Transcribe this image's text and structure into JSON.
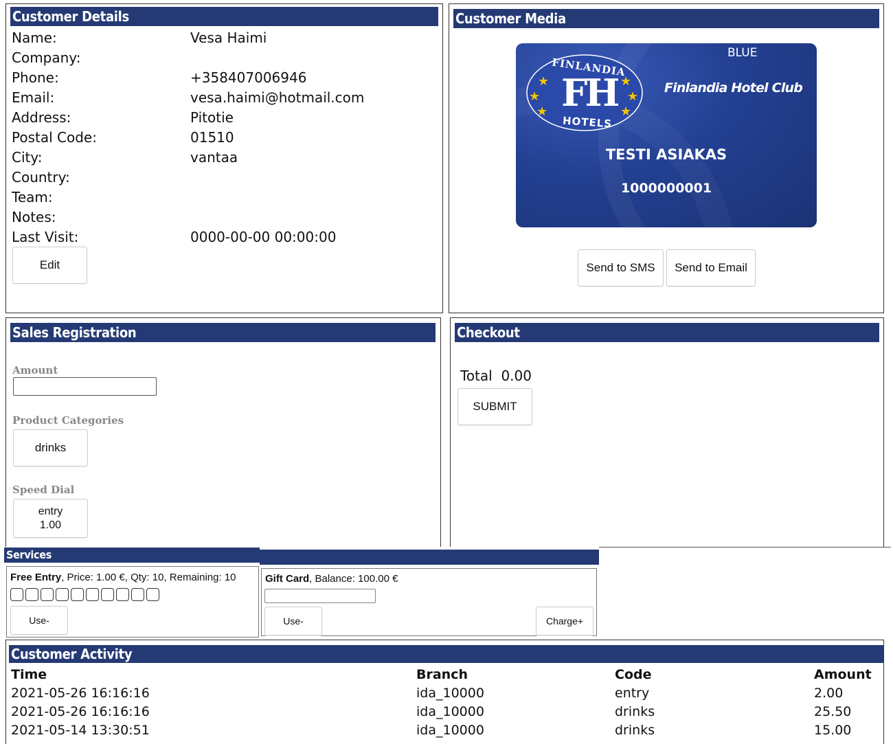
{
  "customer_details": {
    "title": "Customer Details",
    "fields": [
      {
        "label": "Name:",
        "value": "Vesa Haimi"
      },
      {
        "label": "Company:",
        "value": ""
      },
      {
        "label": "Phone:",
        "value": "+358407006946"
      },
      {
        "label": "Email:",
        "value": "vesa.haimi@hotmail.com"
      },
      {
        "label": "Address:",
        "value": "Pitotie"
      },
      {
        "label": "Postal Code:",
        "value": "01510"
      },
      {
        "label": "City:",
        "value": "vantaa"
      },
      {
        "label": "Country:",
        "value": ""
      },
      {
        "label": "Team:",
        "value": ""
      },
      {
        "label": "Notes:",
        "value": ""
      },
      {
        "label": "Last Visit:",
        "value": "0000-00-00 00:00:00"
      }
    ],
    "edit_label": "Edit"
  },
  "customer_media": {
    "title": "Customer Media",
    "card": {
      "tier": "BLUE",
      "logo_top": "FINLANDIA",
      "logo_mark": "FH",
      "logo_bottom": "HOTELS",
      "club_name": "Finlandia Hotel Club",
      "holder": "TESTI ASIAKAS",
      "number": "1000000001",
      "color": "#234092"
    },
    "sms_label": "Send to SMS",
    "email_label": "Send to Email"
  },
  "sales": {
    "title": "Sales Registration",
    "amount_label": "Amount",
    "amount_value": "",
    "categories_label": "Product Categories",
    "category_button": "drinks",
    "speed_dial_label": "Speed Dial",
    "speed_dial_name": "entry",
    "speed_dial_price": "1.00"
  },
  "checkout": {
    "title": "Checkout",
    "total_label": "Total",
    "total_value": "0.00",
    "submit_label": "SUBMIT"
  },
  "services": {
    "title": "Services",
    "free_entry": {
      "name": "Free Entry",
      "details": ", Price: 1.00 €, Qty: 10, Remaining: 10",
      "use_label": "Use-"
    },
    "gift_card": {
      "name": "Gift Card",
      "details": ", Balance: 100.00 €",
      "use_label": "Use-",
      "charge_label": "Charge+"
    }
  },
  "activity": {
    "title": "Customer Activity",
    "columns": [
      "Time",
      "Branch",
      "Code",
      "Amount"
    ],
    "rows": [
      [
        "2021-05-26 16:16:16",
        "ida_10000",
        "entry",
        "2.00"
      ],
      [
        "2021-05-26 16:16:16",
        "ida_10000",
        "drinks",
        "25.50"
      ],
      [
        "2021-05-14 13:30:51",
        "ida_10000",
        "drinks",
        "15.00"
      ]
    ]
  },
  "colors": {
    "header": "#253a74"
  }
}
